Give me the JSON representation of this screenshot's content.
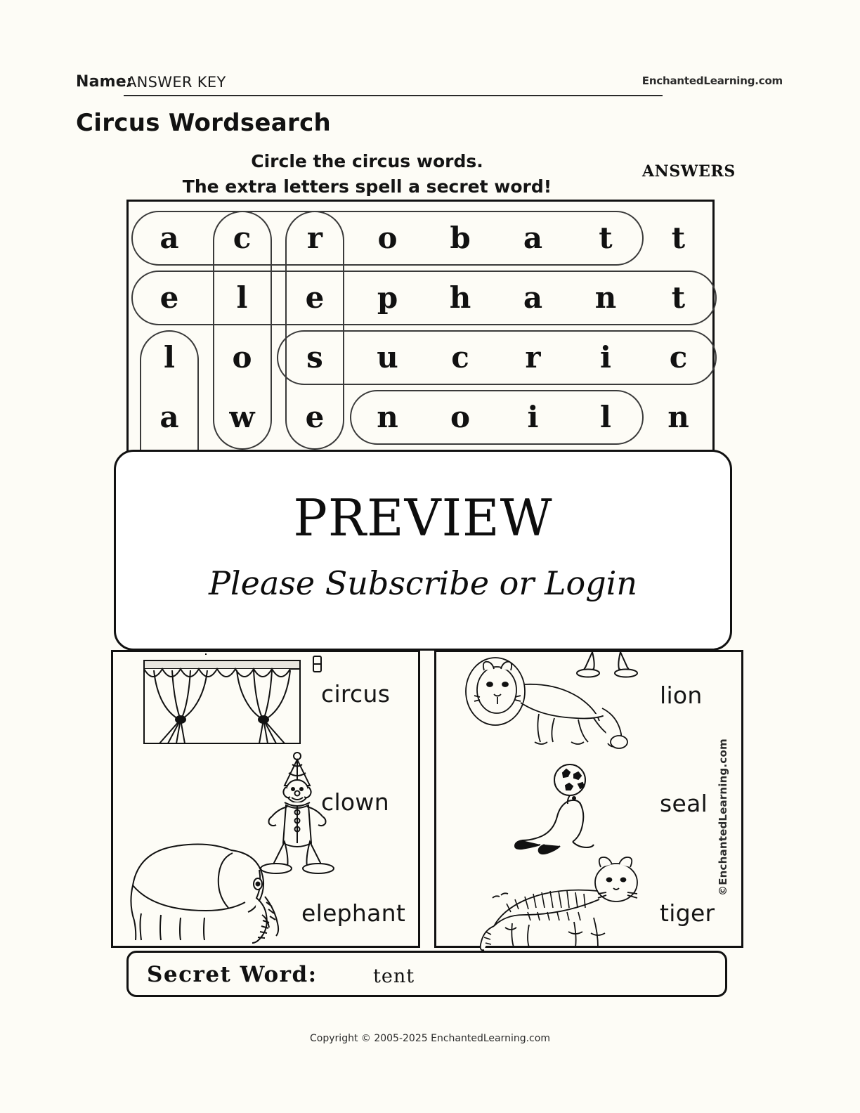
{
  "header": {
    "name_label": "Name:",
    "name_value": "ANSWER KEY",
    "brand": "EnchantedLearning.com",
    "title": "Circus Wordsearch"
  },
  "instructions": {
    "line1": "Circle the circus words.",
    "line2": "The extra letters spell a secret word!",
    "answers_tag": "ANSWERS"
  },
  "grid": {
    "rows": 4,
    "cols": 8,
    "letters": [
      [
        "a",
        "c",
        "r",
        "o",
        "b",
        "a",
        "t",
        "t"
      ],
      [
        "e",
        "l",
        "e",
        "p",
        "h",
        "a",
        "n",
        "t"
      ],
      [
        "l",
        "o",
        "s",
        "u",
        "c",
        "r",
        "i",
        "c"
      ],
      [
        "a",
        "w",
        "e",
        "n",
        "o",
        "i",
        "l",
        "n"
      ]
    ],
    "found_words": [
      {
        "word": "acrobat",
        "direction": "horizontal",
        "row": 1,
        "col_start": 1,
        "col_end": 7
      },
      {
        "word": "elephant",
        "direction": "horizontal",
        "row": 2,
        "col_start": 1,
        "col_end": 8
      },
      {
        "word": "circus",
        "direction": "horizontal-reversed",
        "row": 3,
        "col_start": 3,
        "col_end": 8
      },
      {
        "word": "lion",
        "direction": "horizontal-reversed",
        "row": 4,
        "col_start": 4,
        "col_end": 7
      },
      {
        "word": "clown",
        "direction": "vertical",
        "col": 2,
        "row_start": 1,
        "row_end": 5
      },
      {
        "word": "seal",
        "direction": "vertical",
        "col": 1,
        "row_start": 3,
        "row_end": 6
      },
      {
        "word": "tiger",
        "direction": "vertical",
        "col": 3,
        "row_start": 1,
        "row_end": 5
      }
    ]
  },
  "preview": {
    "title": "PREVIEW",
    "subtitle": "Please Subscribe or Login"
  },
  "picture_panels": [
    {
      "name": "left-panel",
      "items": [
        {
          "word": "circus",
          "icon": "circus-tent-icon"
        },
        {
          "word": "clown",
          "icon": "clown-icon"
        },
        {
          "word": "elephant",
          "icon": "elephant-icon"
        }
      ]
    },
    {
      "name": "right-panel",
      "items": [
        {
          "word": "lion",
          "icon": "lion-icon"
        },
        {
          "word": "seal",
          "icon": "seal-icon"
        },
        {
          "word": "tiger",
          "icon": "tiger-icon"
        }
      ]
    }
  ],
  "watermark": "©EnchantedLearning.com",
  "secret": {
    "label": "Secret Word:",
    "value": "tent"
  },
  "footer": "Copyright © 2005-2025 EnchantedLearning.com",
  "colors": {
    "paper": "#fdfcf6",
    "ink": "#111111",
    "overlay_bg": "#ffffff"
  }
}
